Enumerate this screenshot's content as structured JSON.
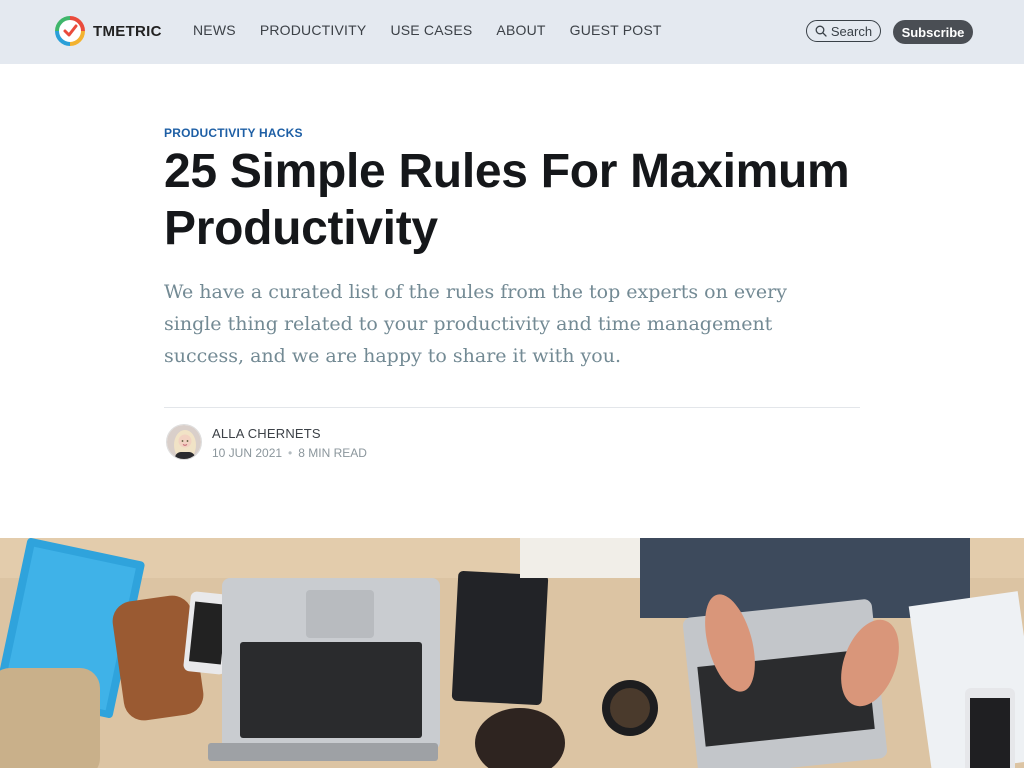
{
  "brand": {
    "name": "TMETRIC"
  },
  "nav": {
    "items": [
      {
        "label": "NEWS"
      },
      {
        "label": "PRODUCTIVITY"
      },
      {
        "label": "USE CASES"
      },
      {
        "label": "ABOUT"
      },
      {
        "label": "GUEST POST"
      }
    ]
  },
  "header_actions": {
    "search_label": "Search",
    "subscribe_label": "Subscribe"
  },
  "article": {
    "tag": "PRODUCTIVITY HACKS",
    "title": "25 Simple Rules For Maximum Productivity",
    "excerpt": "We have a curated list of the rules from the top experts on every single thing related to your productivity and time management success, and we are happy to share it with you.",
    "author": "ALLA CHERNETS",
    "date": "10 JUN 2021",
    "separator": "•",
    "read_time": "8 MIN READ"
  },
  "colors": {
    "header_bg": "#e4e9f0",
    "tag": "#1e5fa5",
    "subscribe_bg": "#4a4e54",
    "excerpt": "#738a94"
  },
  "icons": {
    "logo": "tmetric-check-logo-icon",
    "search": "search-icon"
  }
}
